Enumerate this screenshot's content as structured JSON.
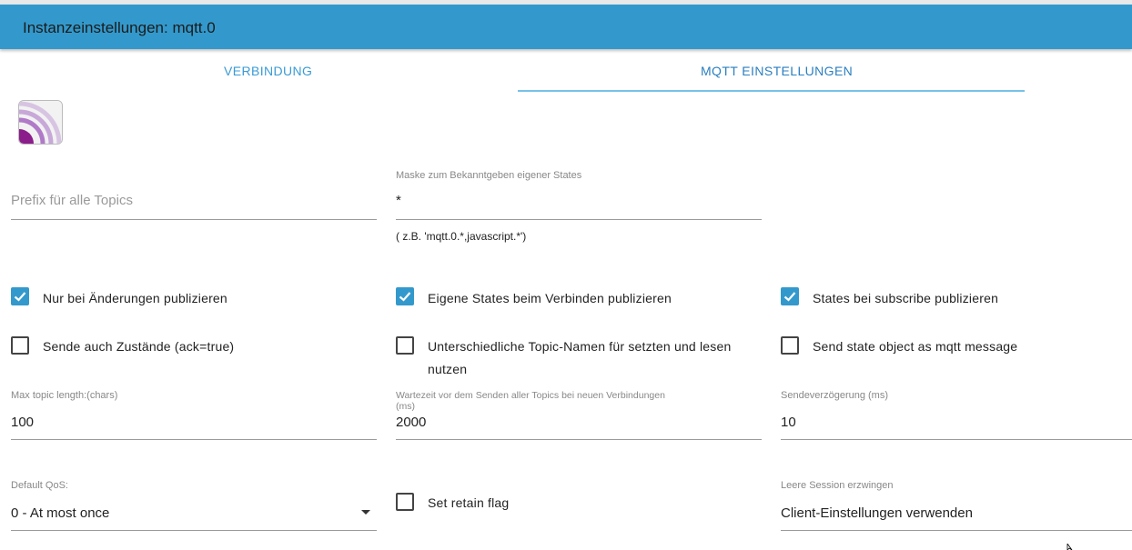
{
  "header": {
    "title": "Instanzeinstellungen: mqtt.0"
  },
  "tabs": [
    {
      "label": "VERBINDUNG"
    },
    {
      "label": "MQTT EINSTELLUNGEN"
    }
  ],
  "logo": {
    "icon": "mqtt-logo-icon",
    "colors": [
      "#8b1e8b",
      "#c7a8d8",
      "#eeeeee"
    ]
  },
  "fields": {
    "prefix": {
      "placeholder": "Prefix für alle Topics",
      "value": ""
    },
    "mask": {
      "label": "Maske zum Bekanntgeben eigener States",
      "value": "*",
      "helper": "( z.B. 'mqtt.0.*,javascript.*')"
    },
    "max_topic_length": {
      "label": "Max topic length:(chars)",
      "value": "100"
    },
    "wait_time": {
      "label": "Wartezeit vor dem Senden aller Topics bei neuen Verbindungen\n(ms)",
      "value": "2000"
    },
    "send_delay": {
      "label": "Sendeverzögerung (ms)",
      "value": "10"
    },
    "default_qos": {
      "label": "Default QoS:",
      "value": "0 - At most once"
    },
    "clean_session": {
      "label": "Leere Session erzwingen",
      "value": "Client-Einstellungen verwenden"
    }
  },
  "checkboxes": {
    "only_changes": {
      "label": "Nur bei Änderungen publizieren",
      "checked": true
    },
    "own_states": {
      "label": "Eigene States beim Verbinden publizieren",
      "checked": true
    },
    "on_subscribe": {
      "label": "States bei subscribe publizieren",
      "checked": true
    },
    "send_ack": {
      "label": "Sende auch Zustände (ack=true)",
      "checked": false
    },
    "different_topics": {
      "label_line1": "Unterschiedliche Topic-Namen für setzten und lesen",
      "label_line2": "nutzen",
      "checked": false
    },
    "state_object": {
      "label": "Send state object as mqtt message",
      "checked": false
    },
    "retain": {
      "label": "Set retain flag",
      "checked": false
    }
  },
  "colors": {
    "header": "#3399cc",
    "accent": "#3399cc",
    "tab_text": "#3a9bd5"
  }
}
